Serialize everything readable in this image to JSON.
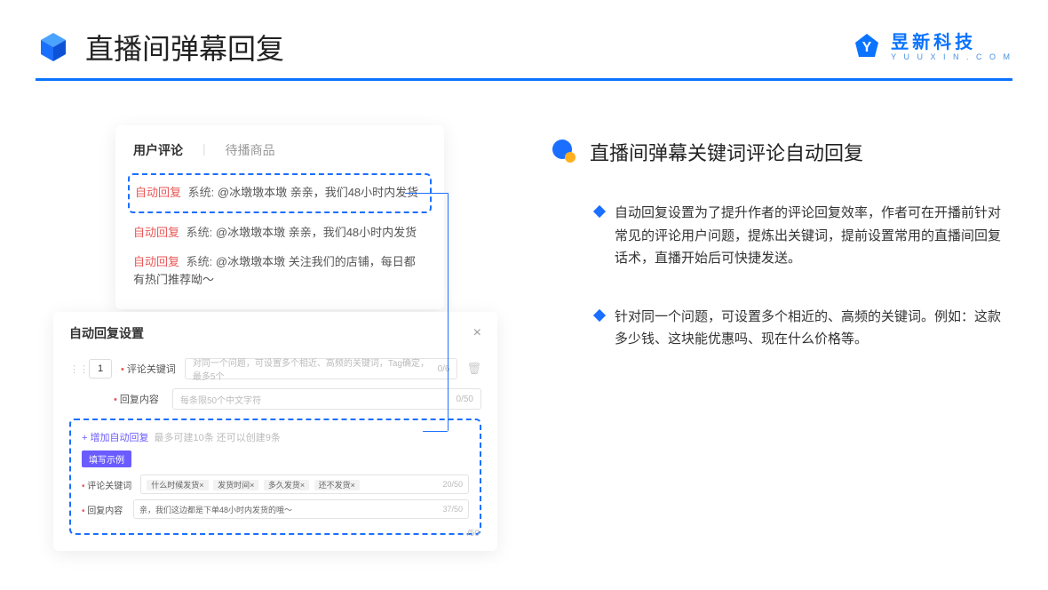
{
  "header": {
    "title": "直播间弹幕回复",
    "brand_cn": "昱新科技",
    "brand_en": "Y U U X I N . C O M"
  },
  "comments": {
    "tab_active": "用户评论",
    "tab_inactive": "待播商品",
    "highlighted": {
      "badge": "自动回复",
      "sys": "系统:",
      "text": "@冰墩墩本墩 亲亲，我们48小时内发货"
    },
    "rows": [
      {
        "badge": "自动回复",
        "sys": "系统:",
        "text": "@冰墩墩本墩 亲亲，我们48小时内发货"
      },
      {
        "badge": "自动回复",
        "sys": "系统:",
        "text": "@冰墩墩本墩 关注我们的店铺，每日都有热门推荐呦～"
      }
    ]
  },
  "settings": {
    "title": "自动回复设置",
    "num": "1",
    "kw_label": "评论关键词",
    "kw_placeholder": "对同一个问题，可设置多个相近、高频的关键词，Tag确定，最多5个",
    "kw_cnt": "0/6",
    "content_label": "回复内容",
    "content_placeholder": "每条限50个中文字符",
    "content_cnt": "0/50",
    "add_link": "+ 增加自动回复",
    "add_hint": "最多可建10条 还可以创建9条",
    "ex_badge": "填写示例",
    "ex_kw_label": "评论关键词",
    "ex_chips": [
      "什么时候发货×",
      "发货时间×",
      "多久发货×",
      "还不发货×"
    ],
    "ex_kw_cnt": "20/50",
    "ex_content_label": "回复内容",
    "ex_content_text": "亲，我们这边都是下单48小时内发货的哦～",
    "ex_content_cnt": "37/50",
    "lone_cnt": "/50"
  },
  "right": {
    "title": "直播间弹幕关键词评论自动回复",
    "b1": "自动回复设置为了提升作者的评论回复效率，作者可在开播前针对常见的评论用户问题，提炼出关键词，提前设置常用的直播间回复话术，直播开始后可快捷发送。",
    "b2": "针对同一个问题，可设置多个相近的、高频的关键词。例如：这款多少钱、这块能优惠吗、现在什么价格等。"
  }
}
